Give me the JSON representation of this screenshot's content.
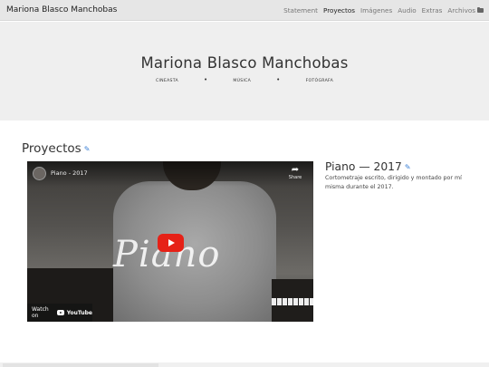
{
  "header": {
    "brand": "Mariona Blasco Manchobas",
    "nav": [
      "Statement",
      "Proyectos",
      "Imágenes",
      "Audio",
      "Extras",
      "Archivos"
    ],
    "active": "Proyectos",
    "archive_icon": "folder-icon"
  },
  "hero": {
    "title": "Mariona Blasco Manchobas",
    "tags": [
      "CINEASTA",
      "MÚSICA",
      "FOTÓGRAFA"
    ],
    "separator": "•"
  },
  "section": {
    "title": "Proyectos",
    "edit_icon": "pencil-icon"
  },
  "video": {
    "title": "Piano - 2017",
    "share_label": "Share",
    "watch_on": "Watch on",
    "platform": "YouTube",
    "overlay_text": "Piano",
    "colors": {
      "play": "#e62117"
    }
  },
  "project": {
    "title": "Piano — 2017",
    "description": "Cortometraje escrito, dirigido y montado por mí misma durante el 2017."
  },
  "colors": {
    "link": "#3a7fd5",
    "header_bg": "#e6e6e6",
    "hero_bg": "#efefef"
  }
}
